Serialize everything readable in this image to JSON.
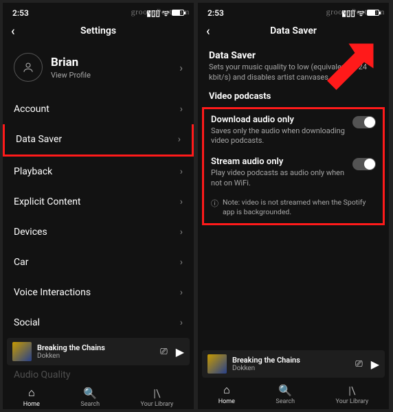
{
  "watermark": "groovyPost.com",
  "statusbar": {
    "time": "2:53"
  },
  "left": {
    "header_title": "Settings",
    "profile": {
      "name": "Brian",
      "view_profile": "View Profile"
    },
    "menu": [
      {
        "label": "Account"
      },
      {
        "label": "Data Saver"
      },
      {
        "label": "Playback"
      },
      {
        "label": "Explicit Content"
      },
      {
        "label": "Devices"
      },
      {
        "label": "Car"
      },
      {
        "label": "Voice Interactions"
      },
      {
        "label": "Social"
      }
    ],
    "cutoff_item": "Audio Quality"
  },
  "right": {
    "header_title": "Data Saver",
    "ds_section": {
      "title": "Data Saver",
      "desc": "Sets your music quality to low (equivalent to 24 kbit/s) and disables artist canvases."
    },
    "vp_heading": "Video podcasts",
    "options": [
      {
        "title": "Download audio only",
        "desc": "Saves only the audio when downloading video podcasts."
      },
      {
        "title": "Stream audio only",
        "desc": "Play video podcasts as audio only when not on WiFi."
      }
    ],
    "note": "Note: video is not streamed when the Spotify app is backgrounded."
  },
  "nowplaying": {
    "track": "Breaking the Chains",
    "artist": "Dokken"
  },
  "tabs": {
    "home": "Home",
    "search": "Search",
    "library": "Your Library"
  },
  "colors": {
    "highlight": "#ff1a1a"
  }
}
